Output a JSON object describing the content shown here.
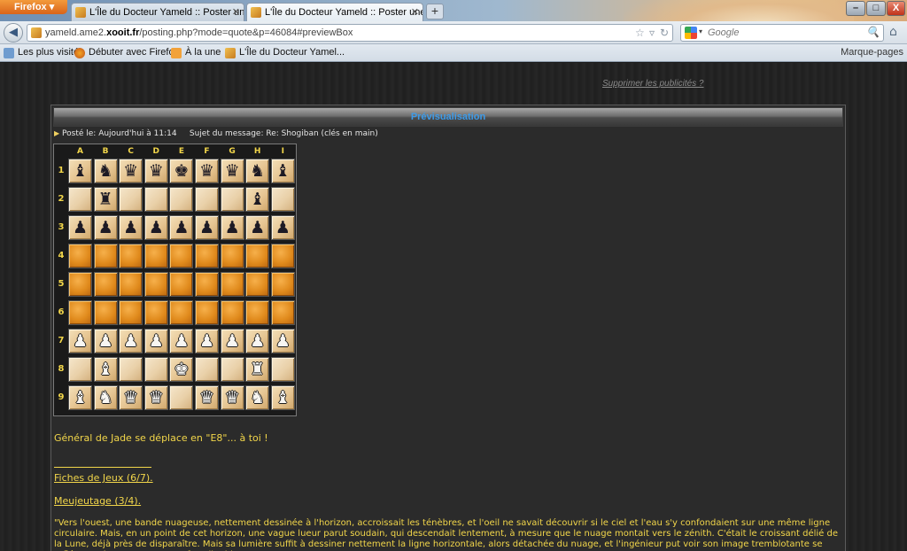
{
  "browser": {
    "app_button": "Firefox",
    "tabs": [
      {
        "label": "L'Île du Docteur Yameld :: Poster une ..."
      },
      {
        "label": "L'Île du Docteur Yameld :: Poster une ..."
      }
    ],
    "new_tab": "+",
    "url": {
      "prefix": "yameld.ame2.",
      "host": "xooit.fr",
      "path": "/posting.php?mode=quote&p=46084#previewBox"
    },
    "search_placeholder": "Google",
    "bookmarks": [
      {
        "label": "Les plus visités"
      },
      {
        "label": "Débuter avec Firefox"
      },
      {
        "label": "À la une"
      },
      {
        "label": "L'Île du Docteur Yamel..."
      }
    ],
    "bookmarks_more": "Marque-pages",
    "window_buttons": {
      "minimize": "–",
      "maximize": "□",
      "close": "X"
    }
  },
  "page": {
    "ad_link": "Supprimer les publicités ?",
    "preview": {
      "title": "Prévisualisation",
      "meta_posted": "Posté le: Aujourd'hui à 11:14",
      "meta_subject": "Sujet du message: Re: Shogiban (clés en main)"
    },
    "board": {
      "columns": [
        "A",
        "B",
        "C",
        "D",
        "E",
        "F",
        "G",
        "H",
        "I"
      ],
      "rows": [
        "1",
        "2",
        "3",
        "4",
        "5",
        "6",
        "7",
        "8",
        "9"
      ],
      "cells": [
        [
          "b:lance",
          "b:knight",
          "b:silver",
          "b:gold",
          "b:king",
          "b:gold",
          "b:silver",
          "b:knight",
          "b:lance"
        ],
        [
          "",
          "b:rook",
          "",
          "",
          "",
          "",
          "",
          "b:bishop",
          ""
        ],
        [
          "b:pawn",
          "b:pawn",
          "b:pawn",
          "b:pawn",
          "b:pawn",
          "b:pawn",
          "b:pawn",
          "b:pawn",
          "b:pawn"
        ],
        [
          "e",
          "e",
          "e",
          "e",
          "e",
          "e",
          "e",
          "e",
          "e"
        ],
        [
          "e",
          "e",
          "e",
          "e",
          "e",
          "e",
          "e",
          "e",
          "e"
        ],
        [
          "e",
          "e",
          "e",
          "e",
          "e",
          "e",
          "e",
          "e",
          "e"
        ],
        [
          "w:pawn",
          "w:pawn",
          "w:pawn",
          "w:pawn",
          "w:pawn",
          "w:pawn",
          "w:pawn",
          "w:pawn",
          "w:pawn"
        ],
        [
          "",
          "w:bishop",
          "",
          "",
          "w:king",
          "",
          "",
          "w:rook",
          ""
        ],
        [
          "w:lance",
          "w:knight",
          "w:silver",
          "w:gold",
          "",
          "w:gold",
          "w:silver",
          "w:knight",
          "w:lance"
        ]
      ],
      "glyphs": {
        "lance": "♝",
        "knight": "♞",
        "silver": "♛",
        "gold": "♛",
        "king": "♚",
        "rook": "♜",
        "bishop": "♝",
        "pawn": "♟"
      }
    },
    "move_text": "Général de Jade se déplace en \"E8\"... à toi !",
    "fiches_link": "Fiches de Jeux (6/7).",
    "meujeutage_link": "Meujeutage (3/4).",
    "quote_text": "\"Vers l'ouest, une bande nuageuse, nettement dessinée à l'horizon, accroissait les ténèbres, et l'oeil ne savait découvrir si le ciel et l'eau s'y confondaient sur une même ligne circulaire. Mais, en un point de cet horizon, une vague lueur parut soudain, qui descendait lentement, à mesure que le nuage montait vers le zénith. C'était le croissant délié de la Lune, déjà près de disparaître. Mais sa lumière suffit à dessiner nettement la ligne horizontale, alors détachée du nuage, et l'ingénieur put voir son image tremblotante se refléter un instant sur une surface liquide. Cyrus"
  }
}
